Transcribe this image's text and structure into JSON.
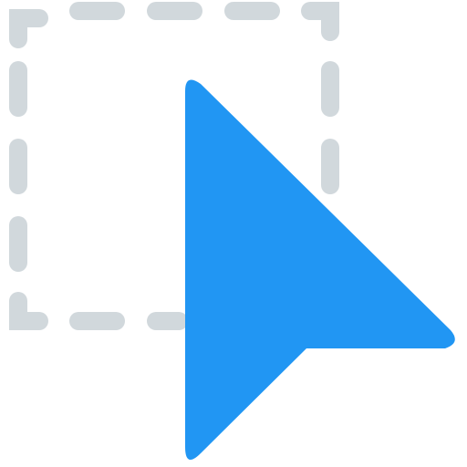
{
  "icon": {
    "name": "selection-cursor-icon",
    "selection_box_color": "#D1D8DC",
    "cursor_color": "#2196F3",
    "background_color": "#FFFFFF"
  }
}
